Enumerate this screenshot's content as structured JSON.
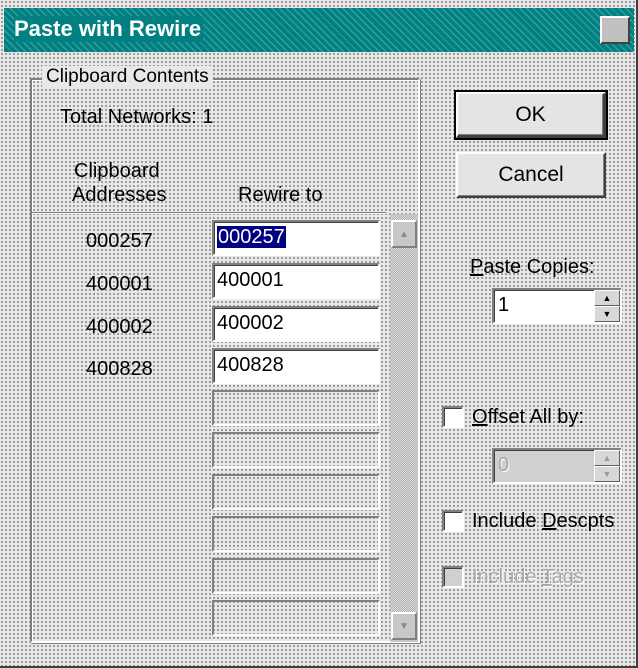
{
  "window": {
    "title": "Paste with Rewire",
    "close_glyph": "✕"
  },
  "group": {
    "legend": "Clipboard Contents",
    "total_networks": "Total Networks: 1",
    "col_clipboard_line1": "Clipboard",
    "col_clipboard_line2": "Addresses",
    "col_rewire": "Rewire to"
  },
  "rows": [
    {
      "address": "000257",
      "rewire": "000257"
    },
    {
      "address": "400001",
      "rewire": "400001"
    },
    {
      "address": "400002",
      "rewire": "400002"
    },
    {
      "address": "400828",
      "rewire": "400828"
    }
  ],
  "buttons": {
    "ok": "OK",
    "cancel": "Cancel"
  },
  "paste_copies": {
    "label_accel": "P",
    "label_rest": "aste Copies:",
    "value": "1"
  },
  "offset": {
    "label_accel": "O",
    "label_rest": "ffset All by:",
    "value": "0",
    "checked": false
  },
  "include_descpts": {
    "label_pre": "Include ",
    "label_accel": "D",
    "label_rest": "escpts",
    "checked": false
  },
  "include_tags": {
    "label_pre": "Include ",
    "label_accel": "T",
    "label_rest": "ags",
    "checked": false,
    "enabled": false
  },
  "icons": {
    "scroll_up": "▲",
    "scroll_down": "▼",
    "spin_up": "▲",
    "spin_down": "▼"
  }
}
